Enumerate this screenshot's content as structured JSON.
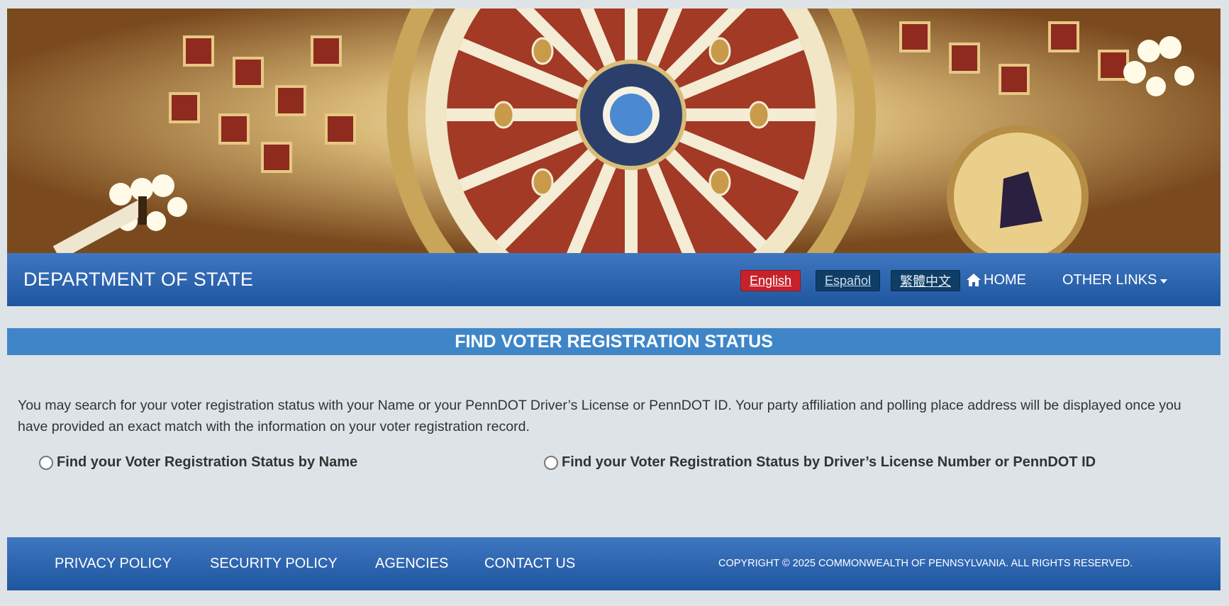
{
  "header": {
    "title": "DEPARTMENT OF STATE",
    "languages": [
      "English",
      "Español",
      "繁體中文"
    ],
    "home_label": "HOME",
    "other_links_label": "OTHER LINKS"
  },
  "main": {
    "title": "FIND VOTER REGISTRATION STATUS",
    "intro": "You may search for your voter registration status with your Name or your PennDOT Driver’s License or PennDOT ID. Your party affiliation and polling place address will be displayed once you have provided an exact match with the information on your voter registration record.",
    "options": [
      "Find your Voter Registration Status by Name",
      "Find your Voter Registration Status by Driver’s License Number or PennDOT ID"
    ]
  },
  "footer": {
    "links": [
      "PRIVACY POLICY",
      "SECURITY POLICY",
      "AGENCIES",
      "CONTACT US"
    ],
    "copyright": "COPYRIGHT © 2025 COMMONWEALTH OF PENNSYLVANIA. ALL RIGHTS RESERVED."
  },
  "colors": {
    "header_blue": "#2a63ad",
    "title_bar": "#3f86c8",
    "english_active": "#c7222c",
    "lang_inactive": "#0e3d66",
    "page_bg": "#dde3e7"
  }
}
